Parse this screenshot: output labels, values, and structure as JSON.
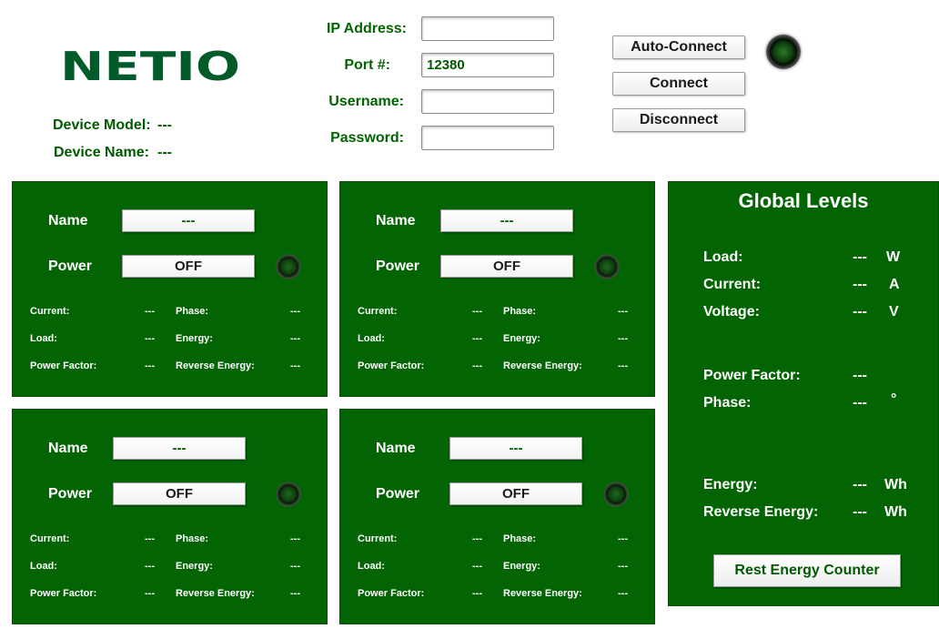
{
  "brand": {
    "logo_text": "NETIO",
    "color": "#005a2a"
  },
  "device": {
    "model_label": "Device Model:",
    "model_value": "---",
    "name_label": "Device Name:",
    "name_value": "---"
  },
  "connection": {
    "ip_label": "IP Address:",
    "ip_value": "",
    "port_label": "Port #:",
    "port_value": "12380",
    "username_label": "Username:",
    "username_value": "",
    "password_label": "Password:",
    "password_value": "",
    "auto_connect_label": "Auto-Connect",
    "connect_label": "Connect",
    "disconnect_label": "Disconnect",
    "status_led": "off"
  },
  "outputs": [
    {
      "name_label": "Name",
      "name_value": "---",
      "power_label": "Power",
      "power_value": "OFF",
      "led": "off",
      "current_label": "Current:",
      "current_value": "---",
      "phase_label": "Phase:",
      "phase_value": "---",
      "load_label": "Load:",
      "load_value": "---",
      "energy_label": "Energy:",
      "energy_value": "---",
      "pf_label": "Power Factor:",
      "pf_value": "---",
      "rev_label": "Reverse Energy:",
      "rev_value": "---"
    },
    {
      "name_label": "Name",
      "name_value": "---",
      "power_label": "Power",
      "power_value": "OFF",
      "led": "off",
      "current_label": "Current:",
      "current_value": "---",
      "phase_label": "Phase:",
      "phase_value": "---",
      "load_label": "Load:",
      "load_value": "---",
      "energy_label": "Energy:",
      "energy_value": "---",
      "pf_label": "Power Factor:",
      "pf_value": "---",
      "rev_label": "Reverse Energy:",
      "rev_value": "---"
    },
    {
      "name_label": "Name",
      "name_value": "---",
      "power_label": "Power",
      "power_value": "OFF",
      "led": "off",
      "current_label": "Current:",
      "current_value": "---",
      "phase_label": "Phase:",
      "phase_value": "---",
      "load_label": "Load:",
      "load_value": "---",
      "energy_label": "Energy:",
      "energy_value": "---",
      "pf_label": "Power Factor:",
      "pf_value": "---",
      "rev_label": "Reverse Energy:",
      "rev_value": "---"
    },
    {
      "name_label": "Name",
      "name_value": "---",
      "power_label": "Power",
      "power_value": "OFF",
      "led": "off",
      "current_label": "Current:",
      "current_value": "---",
      "phase_label": "Phase:",
      "phase_value": "---",
      "load_label": "Load:",
      "load_value": "---",
      "energy_label": "Energy:",
      "energy_value": "---",
      "pf_label": "Power Factor:",
      "pf_value": "---",
      "rev_label": "Reverse Energy:",
      "rev_value": "---"
    }
  ],
  "global": {
    "title": "Global Levels",
    "load_label": "Load:",
    "load_value": "---",
    "load_unit": "W",
    "current_label": "Current:",
    "current_value": "---",
    "current_unit": "A",
    "voltage_label": "Voltage:",
    "voltage_value": "---",
    "voltage_unit": "V",
    "pf_label": "Power Factor:",
    "pf_value": "---",
    "phase_label": "Phase:",
    "phase_value": "---",
    "phase_unit": "°",
    "energy_label": "Energy:",
    "energy_value": "---",
    "energy_unit": "Wh",
    "rev_label": "Reverse Energy:",
    "rev_value": "---",
    "rev_unit": "Wh",
    "reset_label": "Rest Energy Counter"
  },
  "colors": {
    "panel_bg": "#036403",
    "label_green": "#006400",
    "text_white": "#ffffff"
  }
}
